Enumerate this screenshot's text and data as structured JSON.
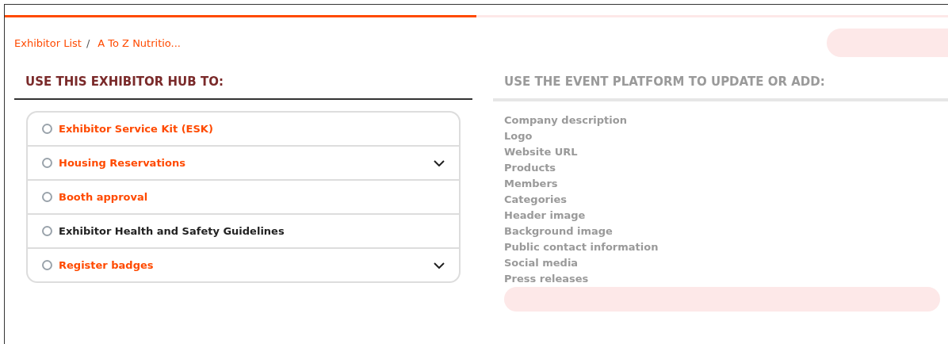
{
  "progress": {
    "level": 0.5
  },
  "breadcrumb": [
    {
      "label": "Exhibitor List"
    },
    {
      "label": "A To Z Nutritio..."
    }
  ],
  "breadcrumb_separator": "/",
  "hub": {
    "heading": "USE THIS EXHIBITOR HUB TO:",
    "items": [
      {
        "label": "Exhibitor Service Kit (ESK)",
        "kind": "link",
        "expandable": false
      },
      {
        "label": "Housing Reservations",
        "kind": "link",
        "expandable": true
      },
      {
        "label": "Booth approval",
        "kind": "link",
        "expandable": false
      },
      {
        "label": "Exhibitor Health and Safety Guidelines",
        "kind": "text",
        "expandable": false
      },
      {
        "label": "Register badges",
        "kind": "link",
        "expandable": true
      }
    ]
  },
  "platform": {
    "disabled": true,
    "heading": "USE THE EVENT PLATFORM TO UPDATE OR ADD:",
    "items": [
      "Company description",
      "Logo",
      "Website URL",
      "Products",
      "Members",
      "Categories",
      "Header image",
      "Background image",
      "Public contact information",
      "Social media",
      "Press releases"
    ]
  }
}
